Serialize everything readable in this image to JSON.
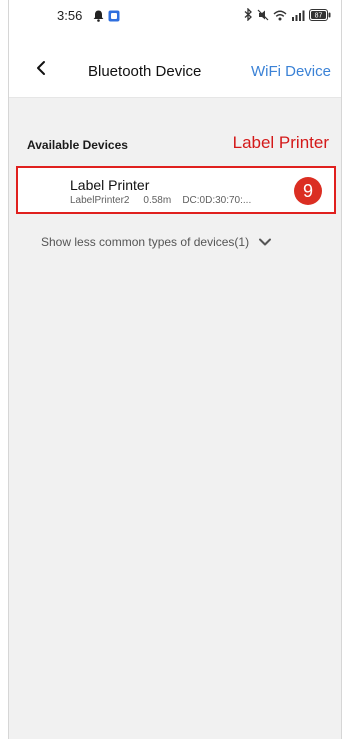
{
  "status_bar": {
    "time": "3:56",
    "left_icons": [
      "notification-icon",
      "app-icon"
    ],
    "right_icons": [
      "bluetooth-icon",
      "mute-icon",
      "wifi-icon",
      "signal-icon",
      "battery-icon"
    ],
    "battery_level": "87"
  },
  "header": {
    "title": "Bluetooth Device",
    "wifi_link": "WiFi Device",
    "back_icon": "back-arrow-icon"
  },
  "section": {
    "title": "Available Devices"
  },
  "annotation": {
    "label": "Label Printer",
    "step": "9",
    "color": "#d41919"
  },
  "device": {
    "name": "Label Printer",
    "model": "LabelPrinter2",
    "distance": "0.58m",
    "address": "DC:0D:30:70:..."
  },
  "show_more": {
    "label": "Show less common types of devices(1)",
    "icon": "chevron-down-icon"
  },
  "colors": {
    "accent": "#3b82d6",
    "highlight": "#e0201e",
    "background": "#f1f1f1"
  }
}
